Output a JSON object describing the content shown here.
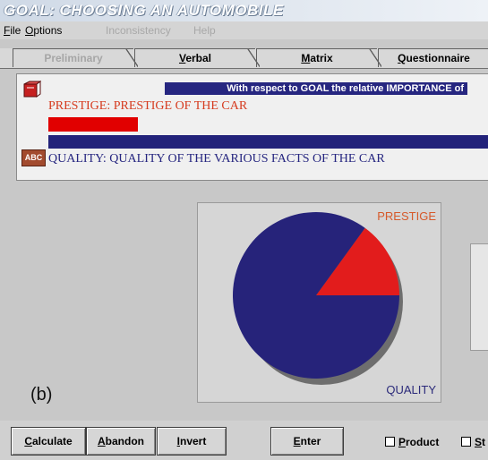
{
  "window": {
    "title": "GOAL: CHOOSING AN AUTOMOBILE"
  },
  "menu": [
    {
      "label": "File",
      "key": "F",
      "rest": "ile",
      "enabled": true
    },
    {
      "label": "Options",
      "key": "O",
      "rest": "ptions",
      "enabled": true
    },
    {
      "label": "Inconsistency",
      "enabled": false
    },
    {
      "label": "Help",
      "enabled": false
    }
  ],
  "tabs": [
    {
      "label": "Preliminary",
      "enabled": false
    },
    {
      "key": "V",
      "rest": "erbal",
      "enabled": true,
      "active": true
    },
    {
      "key": "M",
      "rest": "atrix",
      "enabled": true
    },
    {
      "key": "Q",
      "rest": "uestionnaire",
      "enabled": true
    }
  ],
  "verbal": {
    "header": "With respect to GOAL the relative IMPORTANCE of",
    "element_a": "PRESTIGE: PRESTIGE OF THE CAR",
    "element_b": "QUALITY: QUALITY OF THE VARIOUS FACTS OF THE CAR",
    "abc_icon_text": "ABC"
  },
  "colors": {
    "prestige": "#e10000",
    "quality": "#22227a",
    "header_bg": "#262680"
  },
  "chart_data": {
    "type": "pie",
    "categories": [
      "PRESTIGE",
      "QUALITY"
    ],
    "values": [
      0.15,
      0.85
    ],
    "colors": [
      "#e21c1c",
      "#26237a"
    ],
    "label_colors": [
      "#d65a2b",
      "#2b2a7a"
    ]
  },
  "figure_label": "(b)",
  "buttons": [
    {
      "key": "C",
      "rest": "alculate"
    },
    {
      "key": "A",
      "rest": "bandon"
    },
    {
      "key": "I",
      "rest": "nvert"
    },
    {
      "key": "E",
      "rest": "nter"
    }
  ],
  "checkboxes": [
    {
      "key": "P",
      "rest": "roduct",
      "checked": false
    },
    {
      "key": "S",
      "rest": "t",
      "checked": false
    }
  ]
}
